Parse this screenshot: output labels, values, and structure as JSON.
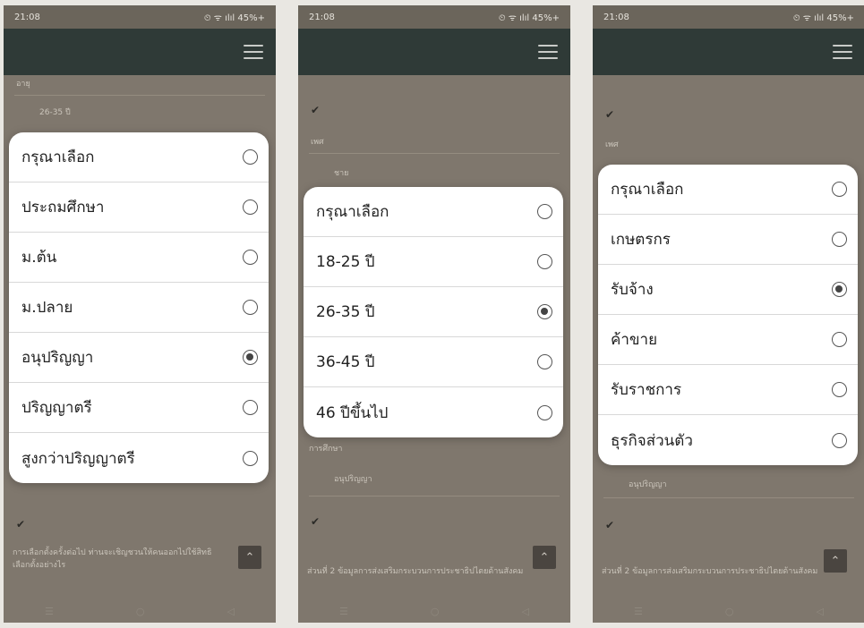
{
  "time": "21:08",
  "status_icons": "⏲ ᯤ ılıl 45%+",
  "phone1": {
    "bg_top_label": "อายุ",
    "bg_top_value": "26-35 ปี",
    "options": [
      {
        "label": "กรุณาเลือก",
        "selected": false
      },
      {
        "label": "ประถมศึกษา",
        "selected": false
      },
      {
        "label": "ม.ต้น",
        "selected": false
      },
      {
        "label": "ม.ปลาย",
        "selected": false
      },
      {
        "label": "อนุปริญญา",
        "selected": true
      },
      {
        "label": "ปริญญาตรี",
        "selected": false
      },
      {
        "label": "สูงกว่าปริญญาตรี",
        "selected": false
      }
    ],
    "bg_question": "การเลือกตั้งครั้งต่อไป ท่านจะเชิญชวนให้คนออกไปใช้สิทธิ",
    "bg_question2": "เลือกตั้งอย่างไร"
  },
  "phone2": {
    "bg_top_label": "เพศ",
    "bg_top_value": "ชาย",
    "options": [
      {
        "label": "กรุณาเลือก",
        "selected": false
      },
      {
        "label": "18-25 ปี",
        "selected": false
      },
      {
        "label": "26-35 ปี",
        "selected": true
      },
      {
        "label": "36-45 ปี",
        "selected": false
      },
      {
        "label": "46 ปีขึ้นไป",
        "selected": false
      }
    ],
    "bg_mid_label": "การศึกษา",
    "bg_mid_value": "อนุปริญญา",
    "bg_section": "ส่วนที่ 2 ข้อมูลการส่งเสริมกระบวนการประชาธิปไตยด้านสังคม"
  },
  "phone3": {
    "bg_top_label": "เพศ",
    "options": [
      {
        "label": "กรุณาเลือก",
        "selected": false
      },
      {
        "label": "เกษตรกร",
        "selected": false
      },
      {
        "label": "รับจ้าง",
        "selected": true
      },
      {
        "label": "ค้าขาย",
        "selected": false
      },
      {
        "label": "รับราชการ",
        "selected": false
      },
      {
        "label": "ธุรกิจส่วนตัว",
        "selected": false
      }
    ],
    "bg_mid_value": "อนุปริญญา",
    "bg_section": "ส่วนที่ 2 ข้อมูลการส่งเสริมกระบวนการประชาธิปไตยด้านสังคม"
  },
  "colors": {
    "appbar": "#2f3a37",
    "overlay": "#7f776d",
    "dialog": "#ffffff",
    "radio": "#444444"
  }
}
